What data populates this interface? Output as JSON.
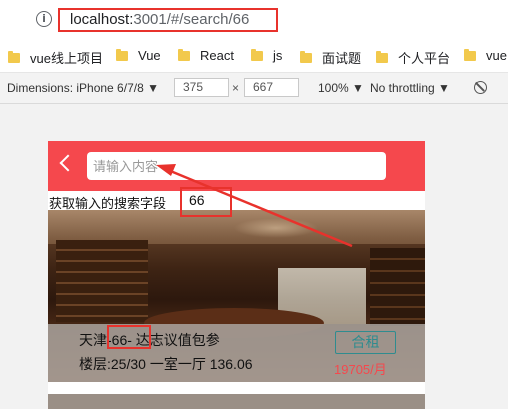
{
  "browser": {
    "url_host": "localhost:",
    "url_rest": "3001/#/search/66",
    "bookmarks": [
      "vue线上项目",
      "Vue",
      "React",
      "js",
      "面试题",
      "个人平台",
      "vue"
    ]
  },
  "devtools": {
    "device_label": "Dimensions: iPhone 6/7/8 ▼",
    "width": "375",
    "times": "×",
    "height": "667",
    "zoom": "100% ▼",
    "throttle": "No throttling ▼"
  },
  "app": {
    "search_placeholder": "请输入内容",
    "keyword_label": "获取输入的搜索字段",
    "keyword_value": "66",
    "listing": {
      "title": "天津-66- 达志议值包参",
      "meta": "楼层:25/30 一室一厅 136.06",
      "badge": "合租",
      "price": "19705/月"
    }
  },
  "colors": {
    "header": "#f5484d",
    "annotation": "#e8322c",
    "badge": "#2f8c8f"
  }
}
